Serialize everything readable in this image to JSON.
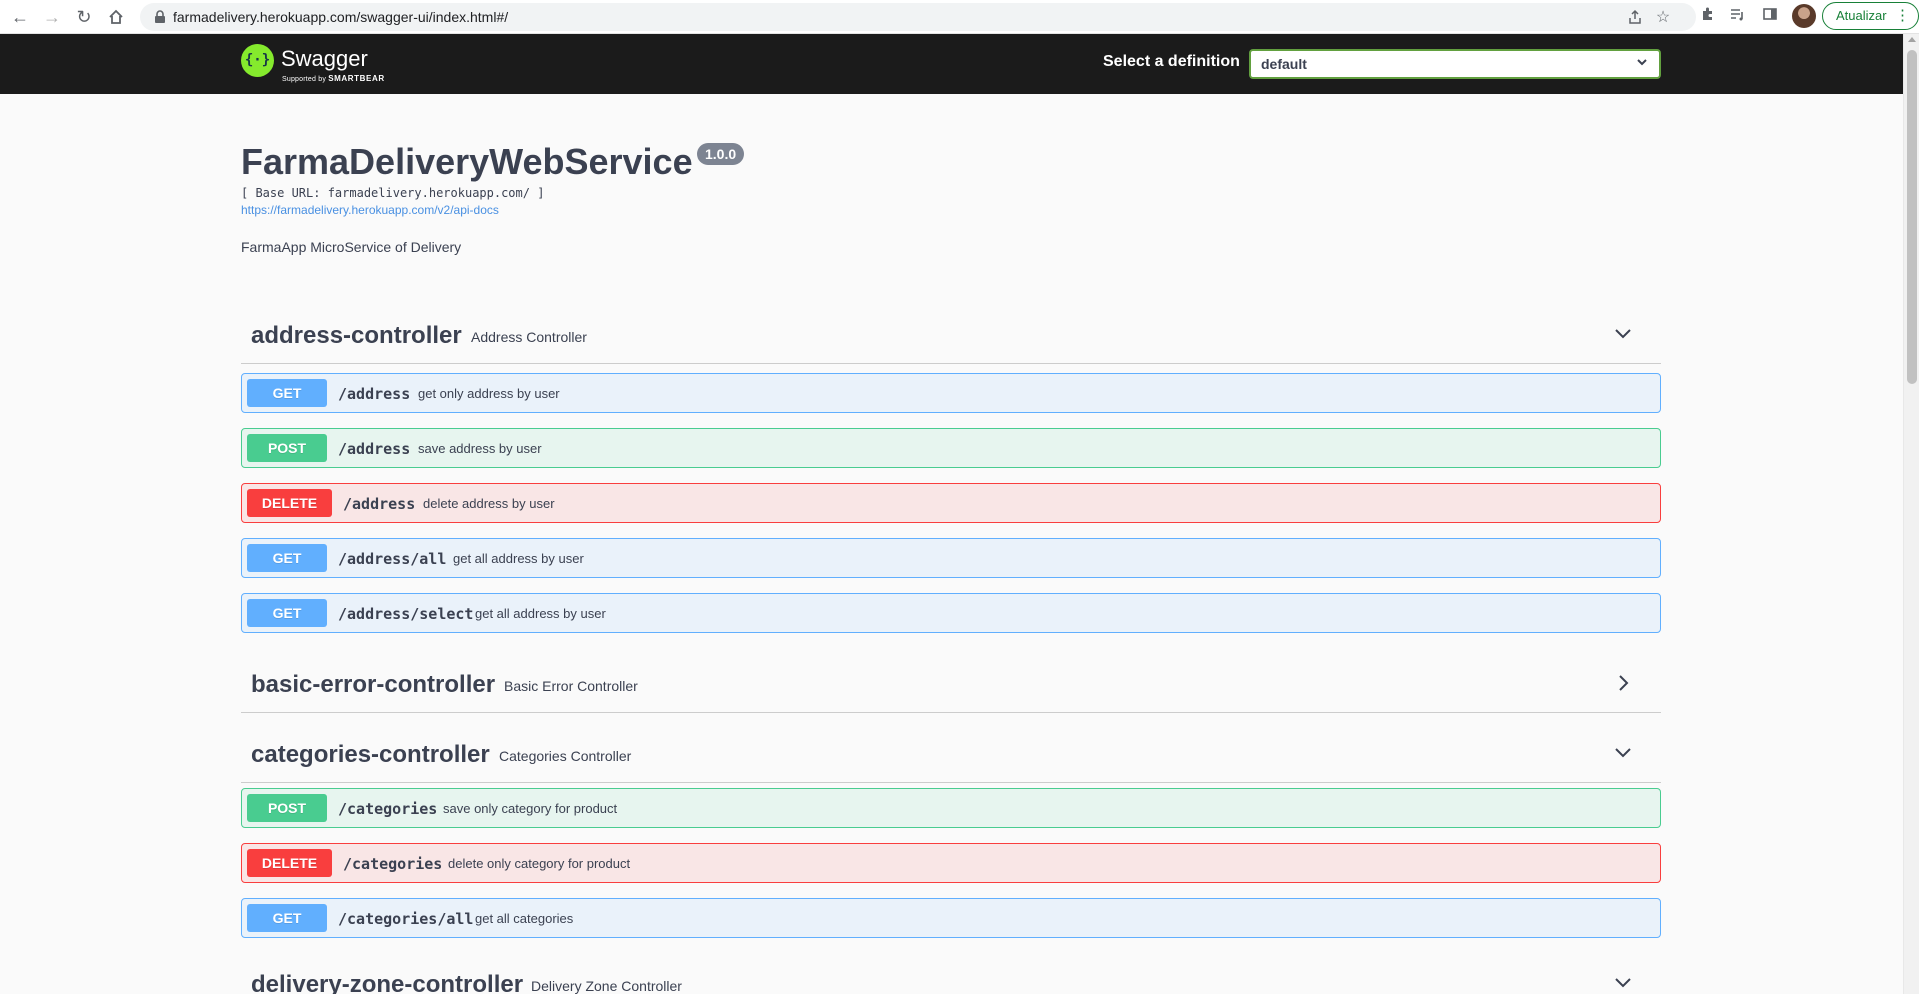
{
  "browser": {
    "url": "farmadelivery.herokuapp.com/swagger-ui/index.html#/",
    "update_label": "Atualizar"
  },
  "topbar": {
    "logo_text": "Swagger",
    "logo_sub_prefix": "Supported by",
    "logo_sub_brand": "SMARTBEAR",
    "definition_label": "Select a definition",
    "definition_value": "default"
  },
  "info": {
    "title": "FarmaDeliveryWebService",
    "version": "1.0.0",
    "base_url": "[ Base URL: farmadelivery.herokuapp.com/ ]",
    "docs_link": "https://farmadelivery.herokuapp.com/v2/api-docs",
    "description": "FarmaApp MicroService of Delivery"
  },
  "tags": [
    {
      "name": "address-controller",
      "description": "Address Controller",
      "expanded": true,
      "operations": [
        {
          "method": "GET",
          "path": "/address",
          "summary": "get only address by user"
        },
        {
          "method": "POST",
          "path": "/address",
          "summary": "save address by user"
        },
        {
          "method": "DELETE",
          "path": "/address",
          "summary": "delete address by user"
        },
        {
          "method": "GET",
          "path": "/address/all",
          "summary": "get all address by user"
        },
        {
          "method": "GET",
          "path": "/address/select",
          "summary": "get all address by user"
        }
      ]
    },
    {
      "name": "basic-error-controller",
      "description": "Basic Error Controller",
      "expanded": false,
      "operations": []
    },
    {
      "name": "categories-controller",
      "description": "Categories Controller",
      "expanded": true,
      "operations": [
        {
          "method": "POST",
          "path": "/categories",
          "summary": "save only category for product"
        },
        {
          "method": "DELETE",
          "path": "/categories",
          "summary": "delete only category for product"
        },
        {
          "method": "GET",
          "path": "/categories/all",
          "summary": "get all categories"
        }
      ]
    },
    {
      "name": "delivery-zone-controller",
      "description": "Delivery Zone Controller",
      "expanded": true,
      "operations": []
    }
  ]
}
